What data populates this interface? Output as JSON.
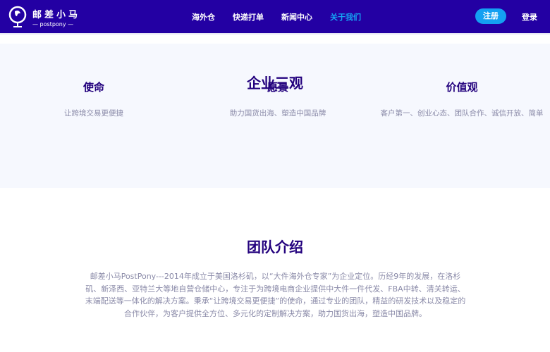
{
  "header": {
    "logo_cn": "邮差小马",
    "logo_en": "— postpony —",
    "nav": [
      {
        "label": "海外仓"
      },
      {
        "label": "快递打单"
      },
      {
        "label": "新闻中心"
      },
      {
        "label": "关于我们",
        "active": true
      }
    ],
    "register": "注册",
    "login": "登录"
  },
  "values": {
    "title": "企业三观",
    "items": [
      {
        "title": "使命",
        "text": "让跨境交易更便捷"
      },
      {
        "title": "愿景",
        "text": "助力国货出海、塑造中国品牌"
      },
      {
        "title": "价值观",
        "text": "客户第一、创业心态、团队合作、诚信开放、简单"
      }
    ]
  },
  "team": {
    "title": "团队介绍",
    "text": "邮差小马PostPony---2014年成立于美国洛杉矶，以“大件海外仓专家”为企业定位。历经9年的发展，在洛杉矶、新泽西、亚特兰大等地自营仓储中心，专注于为跨境电商企业提供中大件一件代发、FBA中转、清关转运、末端配送等一体化的解决方案。秉承“让跨境交易更便捷”的使命，通过专业的团队，精益的研发技术以及稳定的合作伙伴，为客户提供全方位、多元化的定制解决方案，助力国货出海，塑造中国品牌。"
  }
}
